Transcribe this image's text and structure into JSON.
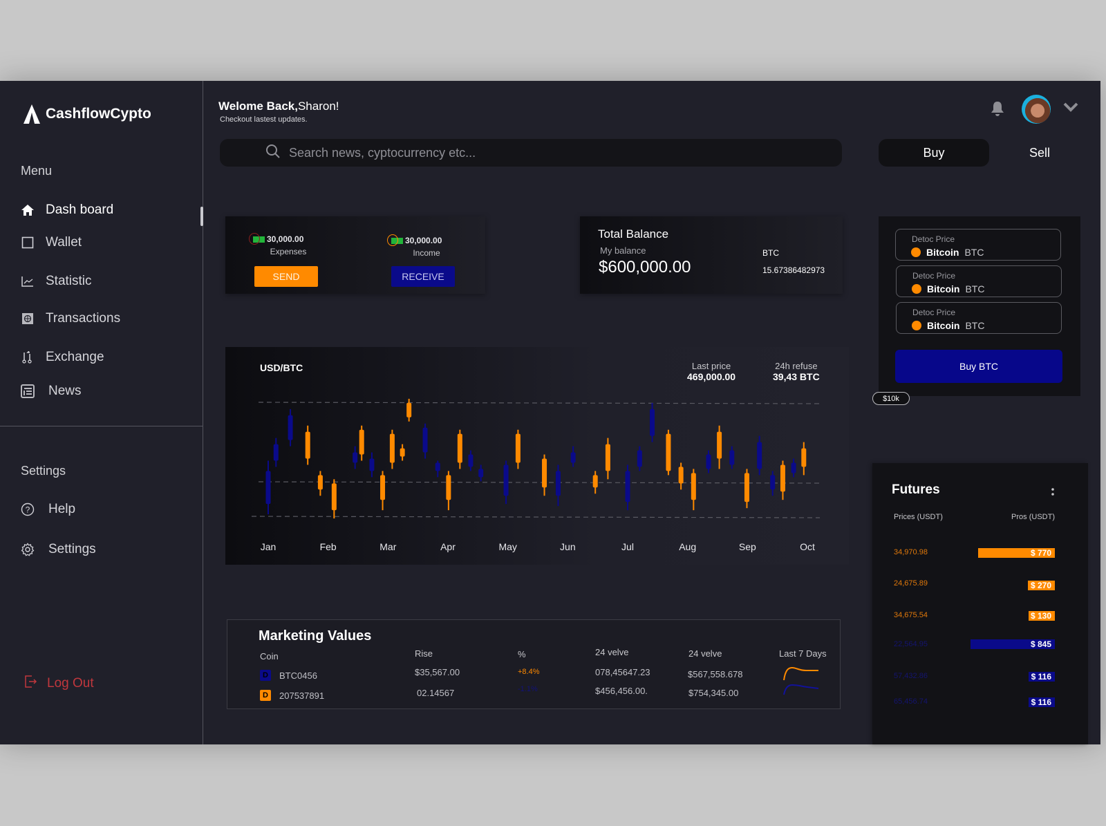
{
  "app": {
    "name": "CashflowCypto"
  },
  "sidebar": {
    "menu_title": "Menu",
    "items": [
      {
        "label": "Dash board",
        "icon": "home-icon"
      },
      {
        "label": "Wallet",
        "icon": "wallet-icon"
      },
      {
        "label": "Statistic",
        "icon": "chart-icon"
      },
      {
        "label": "Transactions",
        "icon": "transactions-icon"
      },
      {
        "label": "Exchange",
        "icon": "exchange-icon"
      },
      {
        "label": "News",
        "icon": "news-icon"
      }
    ],
    "settings_title": "Settings",
    "settings_items": [
      {
        "label": "Help",
        "icon": "help-icon"
      },
      {
        "label": "Settings",
        "icon": "gear-icon"
      }
    ],
    "logout_label": "Log Out"
  },
  "header": {
    "greeting_bold": "Welome Back,",
    "greeting_name": "Sharon!",
    "subtitle": "Checkout lastest updates.",
    "search_placeholder": "Search news, cyptocurrency etc...",
    "buy_tab": "Buy",
    "sell_tab": "Sell"
  },
  "cashflow": {
    "expenses": {
      "amount": "30,000.00",
      "label": "Expenses",
      "button": "SEND"
    },
    "income": {
      "amount": "30,000.00",
      "label": "Income",
      "button": "RECEIVE"
    }
  },
  "balance": {
    "title": "Total Balance",
    "sub": "My balance",
    "amount": "$600,000.00",
    "btc_label": "BTC",
    "btc_value": "15.67386482973"
  },
  "price_panel": {
    "items": [
      {
        "label": "Detoc Price",
        "coin": "Bitcoin",
        "ticker": "BTC"
      },
      {
        "label": "Detoc Price",
        "coin": "Bitcoin",
        "ticker": "BTC"
      },
      {
        "label": "Detoc Price",
        "coin": "Bitcoin",
        "ticker": "BTC"
      }
    ],
    "buy_button": "Buy BTC",
    "tag": "$10k"
  },
  "chart": {
    "title": "USD/BTC",
    "last_price_label": "Last price",
    "last_price": "469,000.00",
    "refuse_label": "24h refuse",
    "refuse_value": "39,43 BTC"
  },
  "chart_data": {
    "type": "candlestick",
    "title": "USD/BTC",
    "categories": [
      "Jan",
      "Feb",
      "Mar",
      "Apr",
      "May",
      "Jun",
      "Jul",
      "Aug",
      "Sep",
      "Oct"
    ],
    "colors": {
      "up": "#ff8a00",
      "down": "#0a0a8a"
    },
    "grid": true,
    "candles": [
      {
        "x": 0.0,
        "open": 52,
        "close": 36,
        "high": 57,
        "low": 31,
        "dir": "down"
      },
      {
        "x": 0.13,
        "open": 65,
        "close": 57,
        "high": 68,
        "low": 54,
        "dir": "down"
      },
      {
        "x": 0.37,
        "open": 79,
        "close": 67,
        "high": 82,
        "low": 64,
        "dir": "down"
      },
      {
        "x": 0.66,
        "open": 58,
        "close": 71,
        "high": 74,
        "low": 55,
        "dir": "up"
      },
      {
        "x": 0.87,
        "open": 43,
        "close": 50,
        "high": 52,
        "low": 40,
        "dir": "up"
      },
      {
        "x": 1.1,
        "open": 33,
        "close": 46,
        "high": 48,
        "low": 29,
        "dir": "up"
      },
      {
        "x": 1.45,
        "open": 61,
        "close": 56,
        "high": 64,
        "low": 53,
        "dir": "down"
      },
      {
        "x": 1.56,
        "open": 60,
        "close": 72,
        "high": 74,
        "low": 57,
        "dir": "up"
      },
      {
        "x": 1.73,
        "open": 58,
        "close": 52,
        "high": 61,
        "low": 49,
        "dir": "down"
      },
      {
        "x": 1.91,
        "open": 38,
        "close": 50,
        "high": 52,
        "low": 33,
        "dir": "up"
      },
      {
        "x": 2.07,
        "open": 56,
        "close": 70,
        "high": 72,
        "low": 53,
        "dir": "up"
      },
      {
        "x": 2.24,
        "open": 59,
        "close": 63,
        "high": 65,
        "low": 57,
        "dir": "up"
      },
      {
        "x": 2.35,
        "open": 78,
        "close": 85,
        "high": 87,
        "low": 76,
        "dir": "up"
      },
      {
        "x": 2.62,
        "open": 73,
        "close": 61,
        "high": 75,
        "low": 58,
        "dir": "down"
      },
      {
        "x": 2.83,
        "open": 56,
        "close": 52,
        "high": 57,
        "low": 49,
        "dir": "down"
      },
      {
        "x": 3.01,
        "open": 38,
        "close": 50,
        "high": 52,
        "low": 33,
        "dir": "up"
      },
      {
        "x": 3.2,
        "open": 56,
        "close": 70,
        "high": 72,
        "low": 53,
        "dir": "up"
      },
      {
        "x": 3.38,
        "open": 60,
        "close": 54,
        "high": 62,
        "low": 52,
        "dir": "down"
      },
      {
        "x": 3.55,
        "open": 53,
        "close": 49,
        "high": 55,
        "low": 47,
        "dir": "down"
      },
      {
        "x": 3.97,
        "open": 55,
        "close": 40,
        "high": 57,
        "low": 36,
        "dir": "down"
      },
      {
        "x": 4.17,
        "open": 56,
        "close": 70,
        "high": 72,
        "low": 53,
        "dir": "up"
      },
      {
        "x": 4.61,
        "open": 44,
        "close": 58,
        "high": 60,
        "low": 40,
        "dir": "up"
      },
      {
        "x": 4.84,
        "open": 52,
        "close": 40,
        "high": 55,
        "low": 35,
        "dir": "down"
      },
      {
        "x": 5.09,
        "open": 61,
        "close": 56,
        "high": 64,
        "low": 54,
        "dir": "down"
      },
      {
        "x": 5.46,
        "open": 44,
        "close": 50,
        "high": 52,
        "low": 41,
        "dir": "up"
      },
      {
        "x": 5.67,
        "open": 52,
        "close": 65,
        "high": 68,
        "low": 48,
        "dir": "up"
      },
      {
        "x": 6.0,
        "open": 52,
        "close": 37,
        "high": 55,
        "low": 33,
        "dir": "down"
      },
      {
        "x": 6.2,
        "open": 62,
        "close": 54,
        "high": 64,
        "low": 52,
        "dir": "down"
      },
      {
        "x": 6.41,
        "open": 82,
        "close": 69,
        "high": 85,
        "low": 66,
        "dir": "down"
      },
      {
        "x": 6.68,
        "open": 52,
        "close": 70,
        "high": 72,
        "low": 50,
        "dir": "up"
      },
      {
        "x": 6.89,
        "open": 46,
        "close": 54,
        "high": 56,
        "low": 43,
        "dir": "up"
      },
      {
        "x": 7.1,
        "open": 38,
        "close": 51,
        "high": 53,
        "low": 33,
        "dir": "up"
      },
      {
        "x": 7.35,
        "open": 60,
        "close": 53,
        "high": 62,
        "low": 51,
        "dir": "down"
      },
      {
        "x": 7.53,
        "open": 58,
        "close": 71,
        "high": 74,
        "low": 53,
        "dir": "up"
      },
      {
        "x": 7.74,
        "open": 62,
        "close": 55,
        "high": 64,
        "low": 53,
        "dir": "down"
      },
      {
        "x": 7.99,
        "open": 37,
        "close": 51,
        "high": 53,
        "low": 34,
        "dir": "up"
      },
      {
        "x": 8.2,
        "open": 66,
        "close": 53,
        "high": 69,
        "low": 50,
        "dir": "down"
      },
      {
        "x": 8.42,
        "open": 50,
        "close": 43,
        "high": 52,
        "low": 40,
        "dir": "down"
      },
      {
        "x": 8.59,
        "open": 42,
        "close": 55,
        "high": 57,
        "low": 38,
        "dir": "up"
      },
      {
        "x": 8.77,
        "open": 56,
        "close": 51,
        "high": 58,
        "low": 49,
        "dir": "down"
      },
      {
        "x": 8.94,
        "open": 54,
        "close": 63,
        "high": 66,
        "low": 50,
        "dir": "up"
      }
    ],
    "ylim": [
      25,
      92
    ],
    "xlabel": "",
    "ylabel": ""
  },
  "futures": {
    "title": "Futures",
    "col_prices": "Prices (USDT)",
    "col_pros": "Pros (USDT)",
    "rows": [
      {
        "price": "34,970.98",
        "pros": "$ 770",
        "pros_value": 770,
        "side": "up"
      },
      {
        "price": "24,675.89",
        "pros": "$ 270",
        "pros_value": 270,
        "side": "up"
      },
      {
        "price": "34,675.54",
        "pros": "$ 130",
        "pros_value": 130,
        "side": "up"
      },
      {
        "price": "22,564.95",
        "pros": "$ 845",
        "pros_value": 845,
        "side": "down"
      },
      {
        "price": "57,432.86",
        "pros": "$ 116",
        "pros_value": 116,
        "side": "down"
      },
      {
        "price": "65,456.74",
        "pros": "$ 116",
        "pros_value": 116,
        "side": "down"
      }
    ]
  },
  "marketing": {
    "title": "Marketing Values",
    "headers": {
      "coin": "Coin",
      "rise": "Rise",
      "pct": "%",
      "vol1": "24  velve",
      "vol2": "24 velve",
      "last7": "Last 7 Days"
    },
    "rows": [
      {
        "badge": "D",
        "coin": "BTC0456",
        "rise": "$35,567.00",
        "pct": "+8.4%",
        "vol1": "078,45647.23",
        "vol2": "$567,558.678",
        "trend": "up"
      },
      {
        "badge": "D",
        "coin": "207537891",
        "rise": "02.14567",
        "pct": "-1.1%",
        "vol1": "$456,456.00.",
        "vol2": "$754,345.00",
        "trend": "down"
      }
    ]
  },
  "colors": {
    "accent_orange": "#ff8a00",
    "accent_blue": "#0a0a8a",
    "logout_red": "#c0373d"
  }
}
